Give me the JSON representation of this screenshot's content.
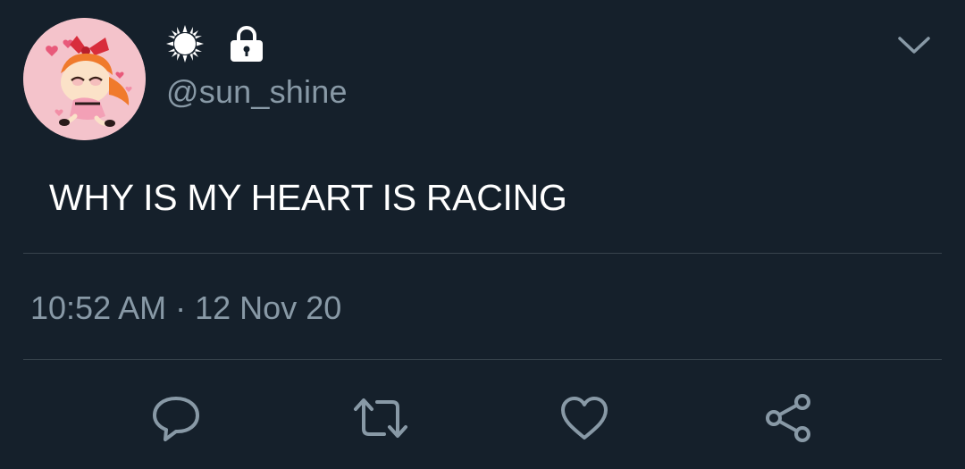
{
  "user": {
    "display_name_icons": [
      "sun-icon",
      "lock-icon"
    ],
    "handle": "@sun_shine",
    "avatar": "avatar"
  },
  "tweet": {
    "text": "WHY IS MY HEART IS RACING",
    "time": "10:52 AM",
    "separator": "·",
    "date": "12 Nov 20"
  },
  "actions": [
    "reply-icon",
    "retweet-icon",
    "like-icon",
    "share-icon"
  ],
  "colors": {
    "background": "#15202b",
    "text_primary": "#ffffff",
    "text_secondary": "#8899a6",
    "divider": "#38444d",
    "avatar_bg": "#f4c3cb"
  }
}
